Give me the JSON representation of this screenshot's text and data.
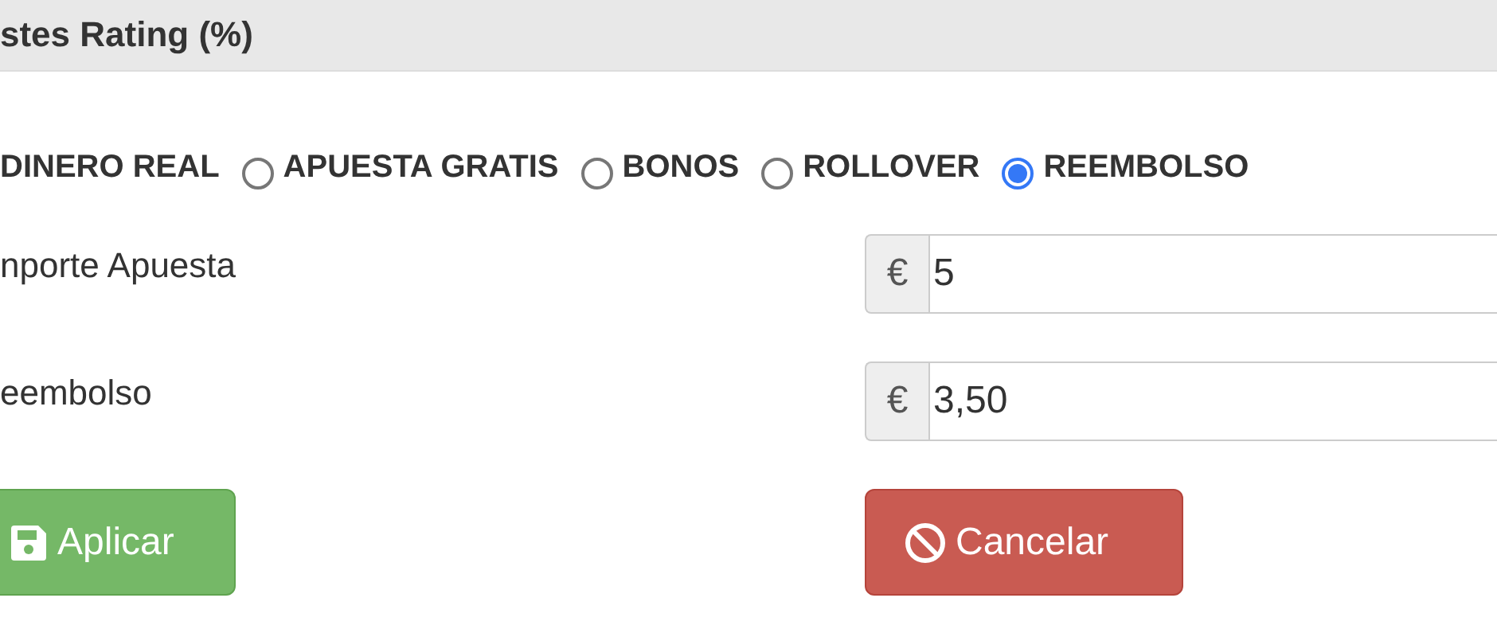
{
  "header": {
    "title": "stes Rating (%)"
  },
  "bet_types": [
    {
      "kind": "label-only",
      "label": "DINERO REAL",
      "selected": false
    },
    {
      "kind": "radio",
      "label": "APUESTA GRATIS",
      "selected": false
    },
    {
      "kind": "radio",
      "label": "BONOS",
      "selected": false
    },
    {
      "kind": "radio",
      "label": "ROLLOVER",
      "selected": false
    },
    {
      "kind": "radio",
      "label": "REEMBOLSO",
      "selected": true
    }
  ],
  "fields": [
    {
      "label": "nporte Apuesta",
      "addon": "€",
      "value": "5"
    },
    {
      "label": "eembolso",
      "addon": "€",
      "value": "3,50"
    }
  ],
  "buttons": [
    {
      "kind": "apply",
      "label": "Aplicar"
    },
    {
      "kind": "cancel",
      "label": "Cancelar"
    }
  ]
}
